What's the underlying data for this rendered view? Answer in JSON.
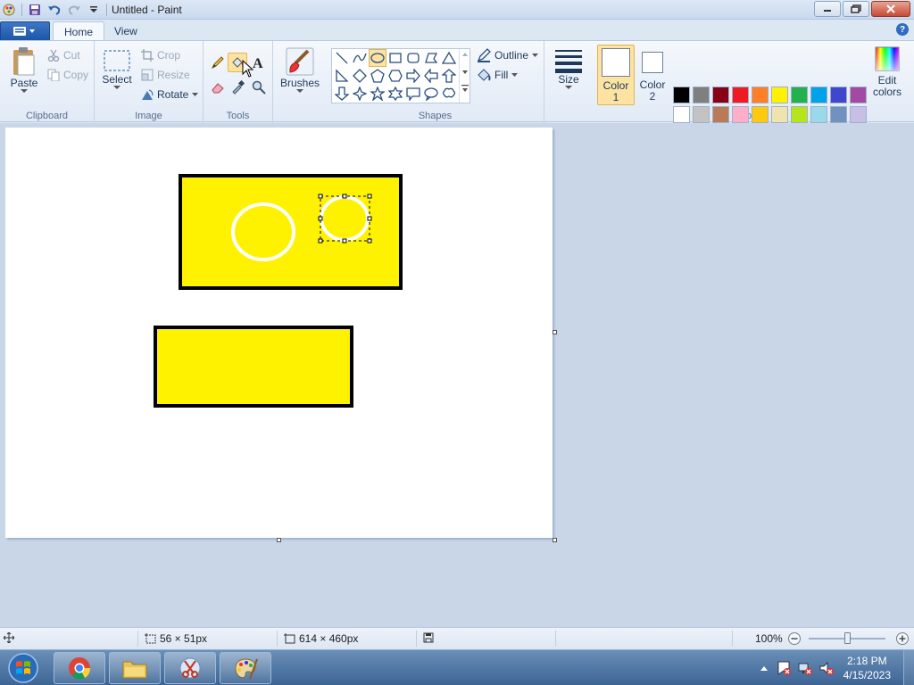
{
  "window": {
    "title": "Untitled - Paint"
  },
  "tabs": [
    {
      "label": "Home",
      "active": true
    },
    {
      "label": "View",
      "active": false
    }
  ],
  "ribbon": {
    "clipboard": {
      "group_label": "Clipboard",
      "paste": "Paste",
      "cut": "Cut",
      "copy": "Copy"
    },
    "image": {
      "group_label": "Image",
      "select": "Select",
      "crop": "Crop",
      "resize": "Resize",
      "rotate": "Rotate"
    },
    "tools": {
      "group_label": "Tools"
    },
    "brushes": {
      "label": "Brushes"
    },
    "shapes": {
      "group_label": "Shapes",
      "outline": "Outline",
      "fill": "Fill"
    },
    "size": {
      "label": "Size"
    },
    "colors": {
      "group_label": "Colors",
      "color1_line1": "Color",
      "color1_line2": "1",
      "color2_line1": "Color",
      "color2_line2": "2",
      "edit_line1": "Edit",
      "edit_line2": "colors",
      "color1_value": "#ffffff",
      "color2_value": "#ffffff",
      "palette_row1": [
        "#000000",
        "#7f7f7f",
        "#880015",
        "#ed1c24",
        "#ff7f27",
        "#fff200",
        "#22b14c",
        "#00a2e8",
        "#3f48cc",
        "#a349a4"
      ],
      "palette_row2": [
        "#ffffff",
        "#c3c3c3",
        "#b97a57",
        "#ffaec9",
        "#ffc90e",
        "#efe4b0",
        "#b5e61d",
        "#99d9ea",
        "#7092be",
        "#c8bfe7"
      ]
    }
  },
  "canvas": {
    "background": "#ffffff",
    "fill_color": "#fff200",
    "outline_color": "#000000"
  },
  "status": {
    "selection_size": "56 × 51px",
    "canvas_size": "614 × 460px",
    "zoom": "100%"
  },
  "taskbar": {
    "time": "2:18 PM",
    "date": "4/15/2023"
  }
}
